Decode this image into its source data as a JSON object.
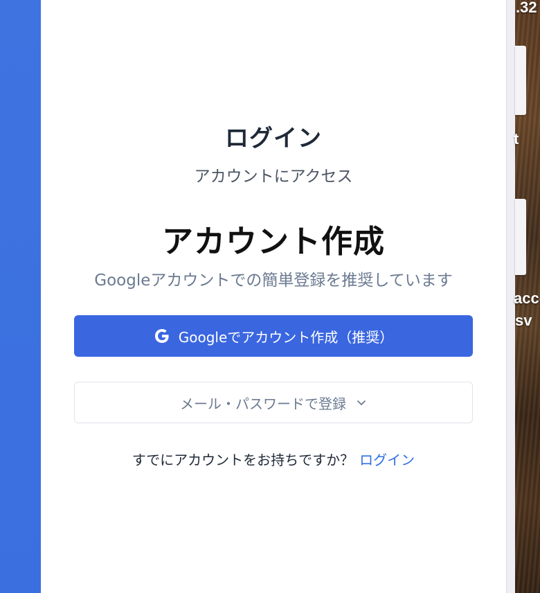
{
  "login_section": {
    "title": "ログイン",
    "subtitle": "アカウントにアクセス"
  },
  "signup_section": {
    "title": "アカウント作成",
    "subtitle": "Googleアカウントでの簡単登録を推奨しています"
  },
  "buttons": {
    "google_signup": "Googleでアカウント作成（推奨）",
    "email_signup": "メール・パスワードで登録"
  },
  "footer": {
    "prompt": "すでにアカウントをお持ちですか？",
    "login_link": "ログイン"
  },
  "desktop": {
    "text_top": ".32",
    "text_mid": "t",
    "text_low1": "acco",
    "text_low2": "sv"
  },
  "icons": {
    "google": "google-g-icon",
    "chevron": "chevron-down-icon"
  },
  "colors": {
    "accent_blue": "#3a66e0",
    "link_blue": "#2f6fe0",
    "left_panel": "#3e73e0"
  }
}
